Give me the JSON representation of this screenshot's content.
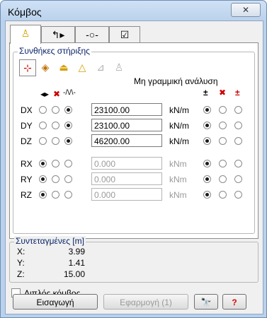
{
  "window": {
    "title": "Κόμβος",
    "close_glyph": "✕"
  },
  "tabs": [
    {
      "icon": "support-icon",
      "glyph": "♙",
      "active": true
    },
    {
      "icon": "local-axes-icon",
      "glyph": "↰▸",
      "active": false
    },
    {
      "icon": "spring-icon",
      "glyph": "-○-",
      "active": false
    },
    {
      "icon": "checkbox-icon",
      "glyph": "☑",
      "active": false
    }
  ],
  "support": {
    "legend": "Συνθήκες στήριξης",
    "icons": [
      {
        "icon": "fixed-spring-support-icon",
        "glyph": "⊹",
        "selected": true
      },
      {
        "icon": "full-fixity-icon",
        "glyph": "◈",
        "selected": false
      },
      {
        "icon": "clamped-support-icon",
        "glyph": "⏏",
        "selected": false
      },
      {
        "icon": "pinned-support-icon",
        "glyph": "△",
        "selected": false
      },
      {
        "icon": "roller-support-icon",
        "glyph": "⊿",
        "selected": false
      },
      {
        "icon": "free-support-icon",
        "glyph": "♙",
        "selected": false
      }
    ],
    "nonlinear_label": "Μη γραμμική ανάλυση",
    "header_icons": {
      "free": "◂▸",
      "fixed": "✖",
      "spring": "-/\\/\\-",
      "nl_both": "±",
      "nl_none": "✖",
      "nl_tension": "±"
    }
  },
  "dofs": [
    {
      "label": "DX",
      "state": 2,
      "value": "23100.00",
      "unit": "kN/m",
      "enabled": true,
      "nl": 0
    },
    {
      "label": "DY",
      "state": 2,
      "value": "23100.00",
      "unit": "kN/m",
      "enabled": true,
      "nl": 0
    },
    {
      "label": "DZ",
      "state": 2,
      "value": "46200.00",
      "unit": "kN/m",
      "enabled": true,
      "nl": 0
    },
    {
      "label": "RX",
      "state": 0,
      "value": "0.000",
      "unit": "kNm",
      "enabled": false,
      "nl": 0
    },
    {
      "label": "RY",
      "state": 0,
      "value": "0.000",
      "unit": "kNm",
      "enabled": false,
      "nl": 0
    },
    {
      "label": "RZ",
      "state": 0,
      "value": "0.000",
      "unit": "kNm",
      "enabled": false,
      "nl": 0
    }
  ],
  "coordinates": {
    "legend": "Συντεταγμένες [m]",
    "items": [
      {
        "label": "X:",
        "value": "3.99"
      },
      {
        "label": "Y:",
        "value": "1.41"
      },
      {
        "label": "Z:",
        "value": "15.00"
      }
    ]
  },
  "double_node": {
    "label": "Διπλός κόμβος",
    "checked": false
  },
  "buttons": {
    "insert": "Εισαγωγή",
    "apply": "Εφαρμογή (1)",
    "find_glyph": "🔭",
    "help_glyph": "?"
  }
}
